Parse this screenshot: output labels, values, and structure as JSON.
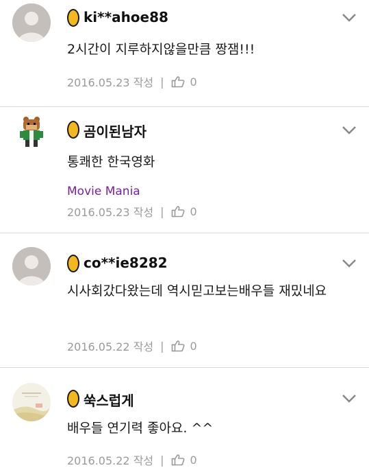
{
  "comments": [
    {
      "nickname": "ki**ahoe88",
      "text": "2시간이 지루하지않을만큼 짱잼!!!",
      "tag": "",
      "date": "2016.05.23 작성",
      "separator": "|",
      "likes": "0",
      "avatar_icon": "default-user-icon"
    },
    {
      "nickname": "곰이된남자",
      "text": "통쾌한 한국영화",
      "tag": "Movie Mania",
      "date": "2016.05.23 작성",
      "separator": "|",
      "likes": "0",
      "avatar_icon": "bear-character-icon"
    },
    {
      "nickname": "co**ie8282",
      "text": "시사회갔다왔는데 역시믿고보는배우들 재밌네요",
      "tag": "",
      "date": "2016.05.22 작성",
      "separator": "|",
      "likes": "0",
      "avatar_icon": "default-user-icon"
    },
    {
      "nickname": "쑥스럽게",
      "text": "배우들 연기력 좋아요. ^^",
      "tag": "",
      "date": "2016.05.22 작성",
      "separator": "|",
      "likes": "0",
      "avatar_icon": "picture-thumbnail-icon"
    }
  ],
  "colors": {
    "tag": "#7a1fa2",
    "badge": "#f3b81e",
    "meta": "#9a9a9a",
    "divider": "#d9d9d9"
  }
}
